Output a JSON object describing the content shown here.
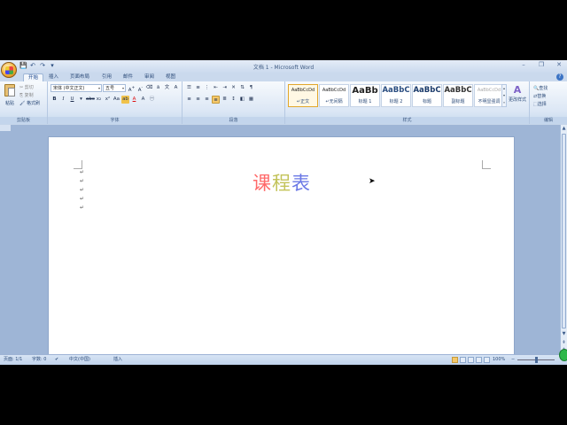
{
  "window": {
    "title": "文档 1 - Microsoft Word",
    "controls": [
      "–",
      "❐",
      "✕"
    ]
  },
  "qat": [
    "💾",
    "↶",
    "↷",
    "▾"
  ],
  "tabs": [
    "开始",
    "插入",
    "页面布局",
    "引用",
    "邮件",
    "审阅",
    "视图"
  ],
  "active_tab": "开始",
  "ribbon": {
    "clipboard": {
      "paste": "粘贴",
      "cut": "剪切",
      "copy": "复制",
      "format_painter": "格式刷",
      "group_label": "剪贴板"
    },
    "font": {
      "font_name": "宋体 (中文正文)",
      "font_size": "五号",
      "group_label": "字体"
    },
    "paragraph": {
      "group_label": "段落"
    },
    "styles": {
      "items": [
        {
          "sample": "AaBbCcDd",
          "name": "↵正文"
        },
        {
          "sample": "AaBbCcDd",
          "name": "↵无间隔"
        },
        {
          "sample": "AaBb",
          "name": "标题 1"
        },
        {
          "sample": "AaBbC",
          "name": "标题 2"
        },
        {
          "sample": "AaBbC",
          "name": "标题"
        },
        {
          "sample": "AaBbC",
          "name": "副标题"
        },
        {
          "sample": "AaBbCcDd",
          "name": "不明显强调"
        }
      ],
      "change_styles": "更改样式",
      "group_label": "样式"
    },
    "editing": {
      "find": "查找",
      "replace": "替换",
      "select": "选择",
      "group_label": "编辑"
    }
  },
  "document": {
    "title_chars": [
      "课",
      "程",
      "表"
    ],
    "paragraph_mark": "↵"
  },
  "statusbar": {
    "page": "页面: 1/1",
    "words": "字数: 0",
    "language": "中文(中国)",
    "insert_mode": "插入",
    "zoom": "100%"
  },
  "colors": {
    "title_char_1": "#ff6a6a",
    "title_char_2": "#c3c35a",
    "title_char_3": "#6a78e6"
  }
}
